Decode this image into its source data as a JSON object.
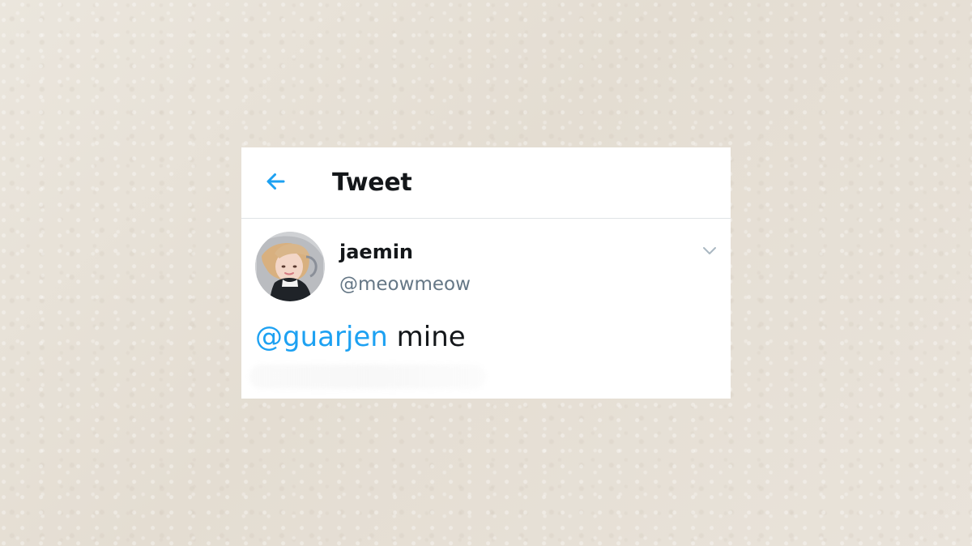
{
  "header": {
    "title": "Tweet",
    "back_icon": "arrow-left-icon",
    "accent_color": "#1da1f2"
  },
  "tweet": {
    "author": {
      "name": "jaemin",
      "handle": "@meowmeow",
      "avatar_icon": "avatar-photo"
    },
    "mention": "@guarjen",
    "text": "mine",
    "menu_icon": "chevron-down-icon"
  },
  "colors": {
    "background": "#e8e2d9",
    "card": "#ffffff",
    "text": "#14171a",
    "secondary_text": "#657786",
    "divider": "#dfe3e6",
    "chevron": "#aab8c2"
  }
}
